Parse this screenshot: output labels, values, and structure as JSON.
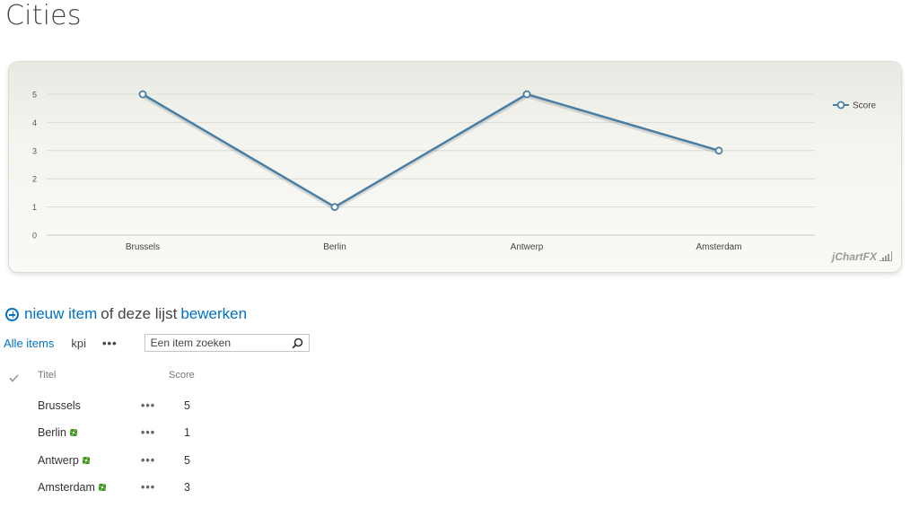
{
  "page": {
    "title": "Cities"
  },
  "chart_data": {
    "type": "line",
    "categories": [
      "Brussels",
      "Berlin",
      "Antwerp",
      "Amsterdam"
    ],
    "series": [
      {
        "name": "Score",
        "values": [
          5,
          1,
          5,
          3
        ],
        "color": "#4a7fa5"
      }
    ],
    "ylim": [
      0,
      5
    ],
    "yticks": [
      0,
      1,
      2,
      3,
      4,
      5
    ],
    "grid": true,
    "legend": "right",
    "brand": "jChartFX"
  },
  "actions": {
    "new_item": "nieuw item",
    "connector": "of deze lijst",
    "edit": "bewerken"
  },
  "views": {
    "all_items": "Alle items",
    "kpi": "kpi",
    "more": "•••",
    "search_placeholder": "Een item zoeken"
  },
  "table": {
    "columns": {
      "title": "Titel",
      "score": "Score"
    },
    "rows": [
      {
        "title": "Brussels",
        "more": "•••",
        "score": "5",
        "is_new": false
      },
      {
        "title": "Berlin",
        "more": "•••",
        "score": "1",
        "is_new": true
      },
      {
        "title": "Antwerp",
        "more": "•••",
        "score": "5",
        "is_new": true
      },
      {
        "title": "Amsterdam",
        "more": "•••",
        "score": "3",
        "is_new": true
      }
    ]
  },
  "colors": {
    "accent": "#0072c6",
    "line": "#4a7fa5",
    "new_badge": "#5aa83c"
  }
}
